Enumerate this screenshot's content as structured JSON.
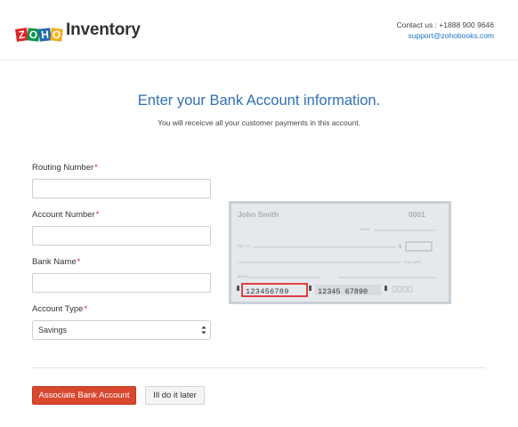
{
  "header": {
    "logo": {
      "letters": [
        "Z",
        "O",
        "H",
        "O"
      ],
      "product": "Inventory"
    },
    "contact_line": "Contact us : +1888 900 9646",
    "contact_email": "support@zohobooks.com"
  },
  "main": {
    "title": "Enter your Bank Account information.",
    "subtitle": "You will receicve all your customer payments in this account."
  },
  "form": {
    "routing_label": "Routing Number",
    "account_label": "Account Number",
    "bank_label": "Bank Name",
    "account_type_label": "Account Type",
    "required_mark": "*",
    "routing_value": "",
    "account_value": "",
    "bank_value": "",
    "account_type_value": "Savings"
  },
  "check": {
    "name": "John Smith",
    "number": "0001",
    "date_label": "DATE",
    "pay_to_label": "PAY TO",
    "currency_symbol": "$",
    "dollars_label": "DOLLARS",
    "memo_label": "MEMO",
    "routing_digits": "123456789",
    "account_digits": "12345 67890",
    "highlight_color": "#e0161b"
  },
  "actions": {
    "primary_label": "Associate Bank Account",
    "secondary_label": "Ill do it later"
  },
  "colors": {
    "brand_blue": "#2f6fb4",
    "primary_button": "#d9472f",
    "required": "#d9262c"
  }
}
